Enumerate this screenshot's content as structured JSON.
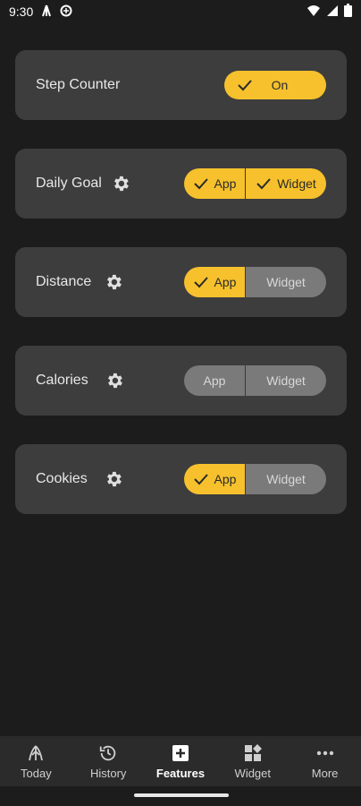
{
  "status": {
    "time": "9:30"
  },
  "features": [
    {
      "label": "Step Counter",
      "type": "single",
      "value": "On",
      "on": true
    },
    {
      "label": "Daily Goal",
      "type": "seg",
      "gear": true,
      "app_label": "App",
      "widget_label": "Widget",
      "app_on": true,
      "widget_on": true
    },
    {
      "label": "Distance",
      "type": "seg",
      "gear": true,
      "app_label": "App",
      "widget_label": "Widget",
      "app_on": true,
      "widget_on": false
    },
    {
      "label": "Calories",
      "type": "seg",
      "gear": true,
      "app_label": "App",
      "widget_label": "Widget",
      "app_on": false,
      "widget_on": false
    },
    {
      "label": "Cookies",
      "type": "seg",
      "gear": true,
      "app_label": "App",
      "widget_label": "Widget",
      "app_on": true,
      "widget_on": false
    }
  ],
  "nav": [
    {
      "label": "Today",
      "icon": "today-icon",
      "active": false
    },
    {
      "label": "History",
      "icon": "history-icon",
      "active": false
    },
    {
      "label": "Features",
      "icon": "features-icon",
      "active": true
    },
    {
      "label": "Widget",
      "icon": "widget-icon",
      "active": false
    },
    {
      "label": "More",
      "icon": "more-icon",
      "active": false
    }
  ],
  "colors": {
    "accent": "#f6c12c",
    "card": "#3d3d3d",
    "off": "#7a7a7a",
    "background": "#1c1c1c"
  }
}
